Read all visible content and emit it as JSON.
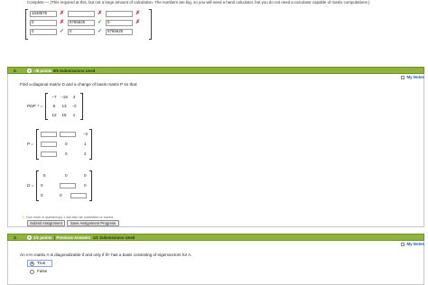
{
  "top_instruction": "Complete — (This required at this, but not a large amount of calculation. The numbers are big, so you will need a hand calculator, but you do not need a calculator capable of matrix computations.)",
  "grid": {
    "rows": [
      {
        "cells": [
          "1048576",
          "",
          ""
        ],
        "marks": [
          "x",
          "x"
        ]
      },
      {
        "cells": [
          "0",
          "9765625",
          "0"
        ],
        "marks": [
          "ok",
          "x"
        ]
      },
      {
        "cells": [
          "0",
          "0",
          "9765625"
        ],
        "marks": [
          "ok",
          "ok"
        ]
      }
    ]
  },
  "question2": {
    "number": "2.",
    "plus": "+",
    "points_label": "–/8 points",
    "submissions_label": "0/5 Submissions Used",
    "notes_label": "My Notes",
    "prompt": "Find a diagonal matrix D and a change of basis matrix P so that:",
    "expr_label": "PDP⁻¹ =",
    "matrix": [
      [
        "−7",
        "−16",
        "4"
      ],
      [
        "6",
        "13",
        "−2"
      ],
      [
        "12",
        "16",
        "1"
      ]
    ],
    "p_label": "P =",
    "p_fixed": {
      "r1c3": "−2",
      "r2c3": "1",
      "r3c3": "2",
      "r2c2": "0",
      "r3c2": "0"
    },
    "d_label": "D =",
    "d_fixed": {
      "r1c1": "5",
      "r1c2": "0",
      "r1c3": "0",
      "r2c1": "0",
      "r2c3": "0",
      "r3c1": "0",
      "r3c2": "0"
    },
    "warning": "Your work in question(s) 1 will also be submitted or saved.",
    "submit_label": "Submit Assignment",
    "save_label": "Save Assignment Progress"
  },
  "question3": {
    "number": "3.",
    "plus": "+",
    "points_label": "1/1 points",
    "previous_label": "Previous Answers",
    "submissions_label": "1/1 Submissions Used",
    "notes_label": "My Notes",
    "prompt": "An n×n matrix A is diagonalizable if and only if ℝⁿ has a basis consisting of eigenvectors for A.",
    "options": [
      "True",
      "False"
    ],
    "selected": "True"
  },
  "colors": {
    "section_bar": "#8fb33c",
    "wrong": "#cc2222",
    "correct": "#2e9a33",
    "link": "#2255aa"
  }
}
